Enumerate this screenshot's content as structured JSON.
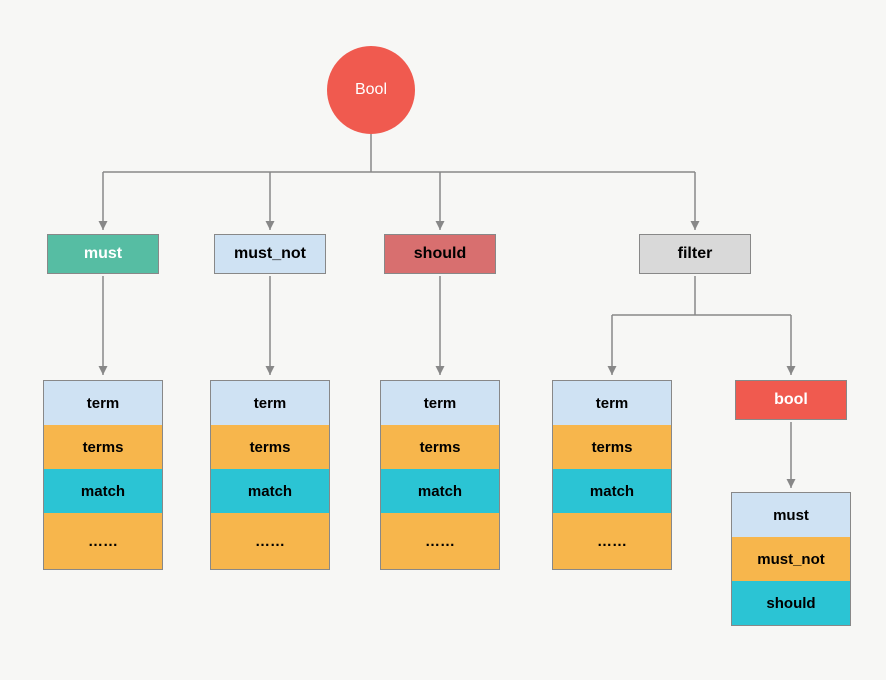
{
  "root": {
    "label": "Bool"
  },
  "level1": {
    "must": {
      "label": "must"
    },
    "must_not": {
      "label": "must_not"
    },
    "should": {
      "label": "should"
    },
    "filter": {
      "label": "filter"
    }
  },
  "stack_items": {
    "term": "term",
    "terms": "terms",
    "match": "match",
    "more": "……"
  },
  "filter_bool": {
    "label": "bool"
  },
  "bool_stack": {
    "must": "must",
    "must_not": "must_not",
    "should": "should"
  },
  "colors": {
    "coral": "#f05a4f",
    "teal": "#56bda3",
    "lightblue": "#cfe2f3",
    "salmon": "#d86f6f",
    "grey": "#d9d9d9",
    "orange": "#f7b64c",
    "cyan": "#2bc4d4"
  }
}
